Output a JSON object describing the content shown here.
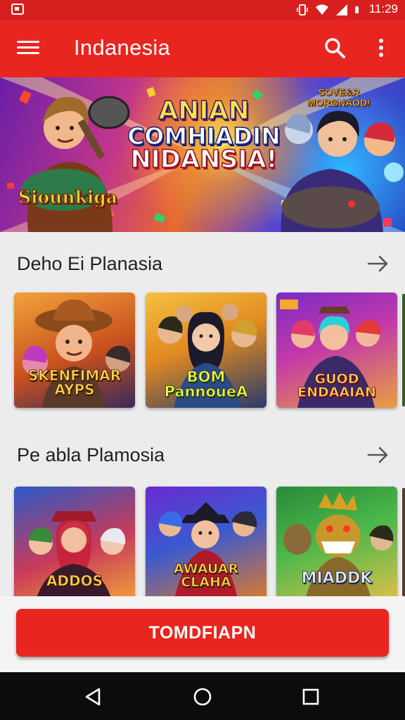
{
  "status_bar": {
    "time": "11:29",
    "icons": [
      "notification-icon",
      "vibrate-icon",
      "wifi-icon",
      "signal-icon",
      "battery-icon"
    ]
  },
  "app_bar": {
    "title": "Indanesia",
    "icons": [
      "menu-icon",
      "search-icon",
      "more-vert-icon"
    ]
  },
  "hero": {
    "headline_line1": "ANIAN",
    "headline_line2": "COMHIADIN",
    "headline_line3": "NIDANSIA!",
    "logo_left": "Siounkiga",
    "logo_right": "SOVE&R MORGNAOD!"
  },
  "sections": [
    {
      "title": "Deho Ei Planasia",
      "cards": [
        {
          "label": "SKENFIMAR AYPS"
        },
        {
          "label": "BOM PannoueA"
        },
        {
          "label": "GUOD ENDAAIAN"
        }
      ]
    },
    {
      "title": "Pe abla Plamosia",
      "cards": [
        {
          "label": "ADDOS"
        },
        {
          "label": "AWAUAR CLAHA"
        },
        {
          "label": "MIADDK"
        }
      ]
    }
  ],
  "cta": {
    "label": "TOMDFIAPN"
  },
  "nav_bar": {
    "icons": [
      "back-icon",
      "home-icon",
      "recents-icon"
    ]
  },
  "colors": {
    "primary": "#e8251f",
    "status_bar": "#d81f1f",
    "background": "#ececec",
    "nav_bar": "#0c0c0c"
  }
}
